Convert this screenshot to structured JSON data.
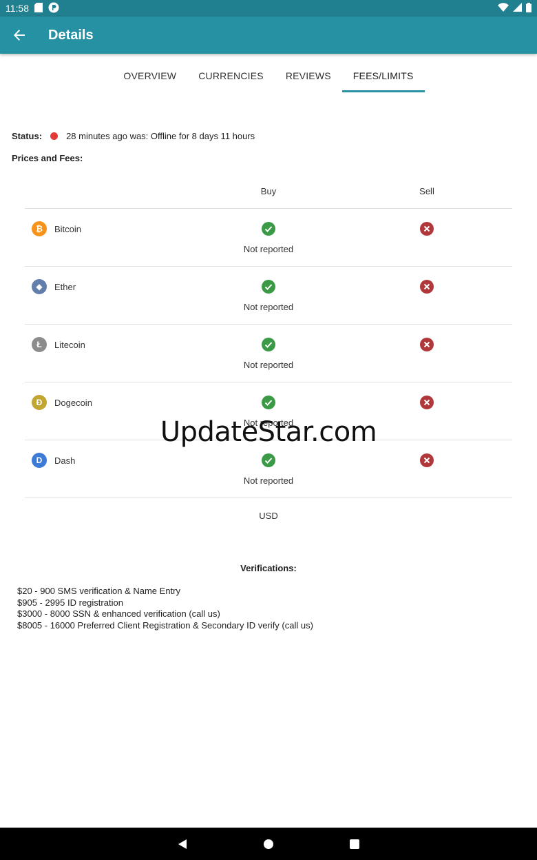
{
  "status_bar": {
    "time": "11:58"
  },
  "app_bar": {
    "title": "Details"
  },
  "tabs": [
    {
      "label": "OVERVIEW",
      "active": false
    },
    {
      "label": "CURRENCIES",
      "active": false
    },
    {
      "label": "REVIEWS",
      "active": false
    },
    {
      "label": "FEES/LIMITS",
      "active": true
    }
  ],
  "status": {
    "label": "Status:",
    "text": "28 minutes ago was: Offline for 8 days 11 hours",
    "color": "#e53935"
  },
  "prices_label": "Prices and Fees:",
  "table": {
    "headers": {
      "buy": "Buy",
      "sell": "Sell"
    },
    "rows": [
      {
        "coin": "Bitcoin",
        "icon": "bitcoin-icon",
        "icon_color": "#f7931a",
        "glyph": "₿",
        "buy": true,
        "buy_note": "Not reported",
        "sell": false
      },
      {
        "coin": "Ether",
        "icon": "ether-icon",
        "icon_color": "#627eaa",
        "glyph": "◆",
        "buy": true,
        "buy_note": "Not reported",
        "sell": false
      },
      {
        "coin": "Litecoin",
        "icon": "litecoin-icon",
        "icon_color": "#8c8c8c",
        "glyph": "Ł",
        "buy": true,
        "buy_note": "Not reported",
        "sell": false
      },
      {
        "coin": "Dogecoin",
        "icon": "dogecoin-icon",
        "icon_color": "#c2a633",
        "glyph": "Ð",
        "buy": true,
        "buy_note": "Not reported",
        "sell": false
      },
      {
        "coin": "Dash",
        "icon": "dash-icon",
        "icon_color": "#3d7bd8",
        "glyph": "D",
        "buy": true,
        "buy_note": "Not reported",
        "sell": false
      }
    ],
    "currency": "USD"
  },
  "watermark": "UpdateStar.com",
  "verifications": {
    "title": "Verifications:",
    "items": [
      "$20 - 900 SMS verification & Name Entry",
      "$905 - 2995 ID registration",
      "$3000 - 8000 SSN & enhanced verification (call us)",
      "$8005 - 16000 Preferred Client Registration & Secondary ID verify (call us)"
    ]
  },
  "colors": {
    "status_bar": "#20808f",
    "app_bar": "#2591a2",
    "check": "#3a9a45",
    "cross": "#b0383a"
  }
}
